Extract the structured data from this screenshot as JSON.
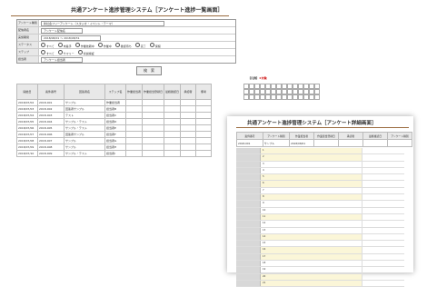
{
  "main": {
    "title": "共通アンケート進捗管理システム［アンケート進捗一覧画面］",
    "form": {
      "rows": [
        {
          "label": "アンケート種別",
          "value": "新社会フリーアンケート（スタジオ・イベント・テーマ）"
        },
        {
          "label": "配信者名",
          "value": "アンケート配信名"
        },
        {
          "label": "実施期間",
          "value": "2018/08/01 ～ 2018/08/31"
        },
        {
          "label": "ステータス",
          "options": [
            "すべて",
            "未着手",
            "作業依頼中",
            "作業中",
            "確認待ち",
            "完了",
            "保留"
          ]
        },
        {
          "label": "ステップ",
          "options": [
            "すべて",
            "サマリー",
            "仮説検証"
          ]
        },
        {
          "label": "担当者",
          "value": "アンケート担当者"
        }
      ],
      "search_label": "検　索"
    },
    "legend": {
      "label": "【凡例】",
      "hit": "★対象"
    },
    "table": {
      "headers": [
        "開始日",
        "案件番号",
        "回答者名",
        "ステップ名",
        "作業担当者",
        "作業担当登録日",
        "最終確認日",
        "承認者",
        "備考"
      ],
      "rows": [
        [
          "2018/07/02",
          "2018-001",
          "サンプル",
          "作業担当者",
          "担当者A"
        ],
        [
          "2018/07/03",
          "2018-002",
          "回答者サンプル",
          "担当者B",
          ""
        ],
        [
          "2018/07/04",
          "2018-003",
          "テスト",
          "担当者C",
          ""
        ],
        [
          "2018/07/05",
          "2018-004",
          "サンプル・テスト",
          "担当者D",
          ""
        ],
        [
          "2018/07/06",
          "2018-005",
          "サンプル・テスト",
          "担当者E",
          ""
        ],
        [
          "2018/07/07",
          "2018-006",
          "回答者サンプル",
          "担当者F",
          ""
        ],
        [
          "2018/07/08",
          "2018-007",
          "サンプル",
          "担当者G",
          ""
        ],
        [
          "2018/07/09",
          "2018-008",
          "サンプル",
          "担当者H",
          ""
        ],
        [
          "2018/07/10",
          "2018-009",
          "サンプル・テスト",
          "担当者I",
          ""
        ]
      ]
    }
  },
  "detail": {
    "title": "共通アンケート進捗管理システム［アンケート詳細画面］",
    "header_row": [
      "案件番号",
      "アンケート種別",
      "作業担当者",
      "作業担当登録日",
      "承認者",
      "最終確認日",
      "アンケート種別"
    ],
    "info_row": [
      "2018-001",
      "サンプル",
      "2018/08/01",
      "",
      "",
      "",
      ""
    ],
    "items": [
      "1",
      "2",
      "3",
      "4",
      "5",
      "6",
      "7",
      "8",
      "9",
      "10",
      "11",
      "12",
      "13",
      "14",
      "15",
      "16",
      "17",
      "18",
      "19",
      "20",
      "21",
      "22",
      "23"
    ]
  }
}
